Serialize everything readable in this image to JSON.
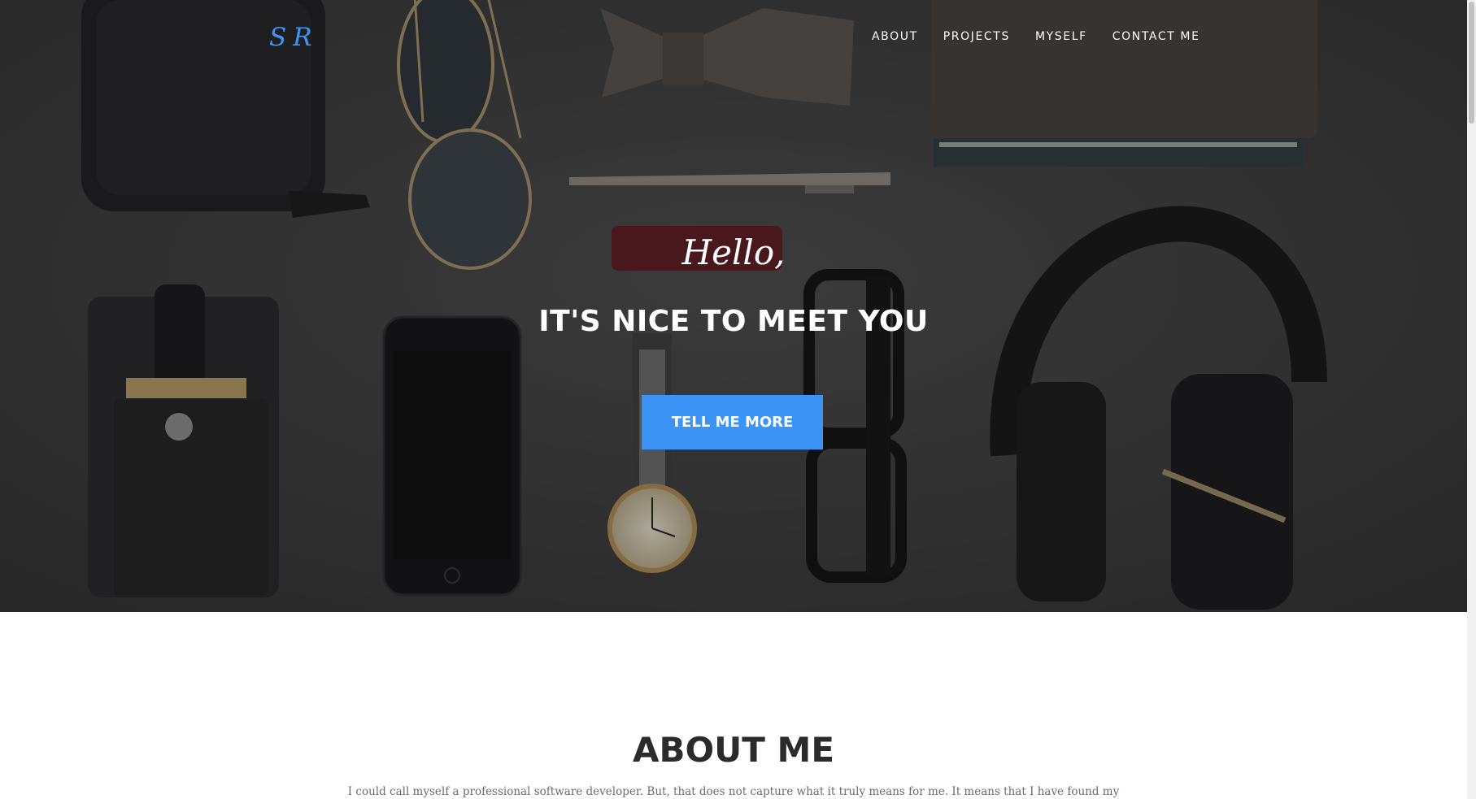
{
  "brand": {
    "logo_text": "SR",
    "color": "#3f96f0"
  },
  "nav": {
    "items": [
      {
        "label": "ABOUT"
      },
      {
        "label": "PROJECTS"
      },
      {
        "label": "MYSELF"
      },
      {
        "label": "CONTACT ME"
      }
    ]
  },
  "hero": {
    "greeting": "Hello,",
    "heading": "IT'S NICE TO MEET YOU",
    "cta_label": "TELL ME MORE",
    "cta_color": "#3b93f5"
  },
  "about": {
    "title": "ABOUT ME",
    "text": "I could call myself a professional software developer. But, that does not capture what it truly means for me. It means that I have found my"
  }
}
